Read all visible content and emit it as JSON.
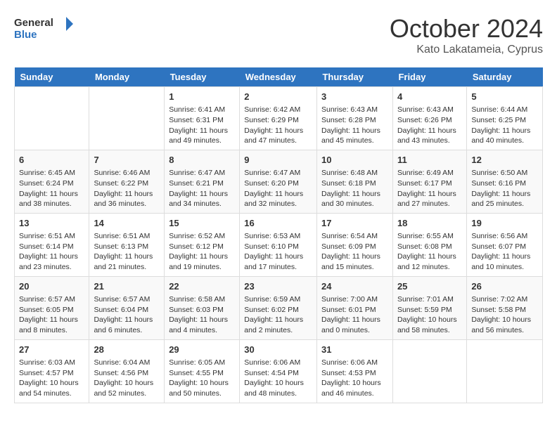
{
  "header": {
    "logo_line1": "General",
    "logo_line2": "Blue",
    "month": "October 2024",
    "location": "Kato Lakatameia, Cyprus"
  },
  "days_of_week": [
    "Sunday",
    "Monday",
    "Tuesday",
    "Wednesday",
    "Thursday",
    "Friday",
    "Saturday"
  ],
  "weeks": [
    [
      {
        "day": "",
        "text": ""
      },
      {
        "day": "",
        "text": ""
      },
      {
        "day": "1",
        "text": "Sunrise: 6:41 AM\nSunset: 6:31 PM\nDaylight: 11 hours and 49 minutes."
      },
      {
        "day": "2",
        "text": "Sunrise: 6:42 AM\nSunset: 6:29 PM\nDaylight: 11 hours and 47 minutes."
      },
      {
        "day": "3",
        "text": "Sunrise: 6:43 AM\nSunset: 6:28 PM\nDaylight: 11 hours and 45 minutes."
      },
      {
        "day": "4",
        "text": "Sunrise: 6:43 AM\nSunset: 6:26 PM\nDaylight: 11 hours and 43 minutes."
      },
      {
        "day": "5",
        "text": "Sunrise: 6:44 AM\nSunset: 6:25 PM\nDaylight: 11 hours and 40 minutes."
      }
    ],
    [
      {
        "day": "6",
        "text": "Sunrise: 6:45 AM\nSunset: 6:24 PM\nDaylight: 11 hours and 38 minutes."
      },
      {
        "day": "7",
        "text": "Sunrise: 6:46 AM\nSunset: 6:22 PM\nDaylight: 11 hours and 36 minutes."
      },
      {
        "day": "8",
        "text": "Sunrise: 6:47 AM\nSunset: 6:21 PM\nDaylight: 11 hours and 34 minutes."
      },
      {
        "day": "9",
        "text": "Sunrise: 6:47 AM\nSunset: 6:20 PM\nDaylight: 11 hours and 32 minutes."
      },
      {
        "day": "10",
        "text": "Sunrise: 6:48 AM\nSunset: 6:18 PM\nDaylight: 11 hours and 30 minutes."
      },
      {
        "day": "11",
        "text": "Sunrise: 6:49 AM\nSunset: 6:17 PM\nDaylight: 11 hours and 27 minutes."
      },
      {
        "day": "12",
        "text": "Sunrise: 6:50 AM\nSunset: 6:16 PM\nDaylight: 11 hours and 25 minutes."
      }
    ],
    [
      {
        "day": "13",
        "text": "Sunrise: 6:51 AM\nSunset: 6:14 PM\nDaylight: 11 hours and 23 minutes."
      },
      {
        "day": "14",
        "text": "Sunrise: 6:51 AM\nSunset: 6:13 PM\nDaylight: 11 hours and 21 minutes."
      },
      {
        "day": "15",
        "text": "Sunrise: 6:52 AM\nSunset: 6:12 PM\nDaylight: 11 hours and 19 minutes."
      },
      {
        "day": "16",
        "text": "Sunrise: 6:53 AM\nSunset: 6:10 PM\nDaylight: 11 hours and 17 minutes."
      },
      {
        "day": "17",
        "text": "Sunrise: 6:54 AM\nSunset: 6:09 PM\nDaylight: 11 hours and 15 minutes."
      },
      {
        "day": "18",
        "text": "Sunrise: 6:55 AM\nSunset: 6:08 PM\nDaylight: 11 hours and 12 minutes."
      },
      {
        "day": "19",
        "text": "Sunrise: 6:56 AM\nSunset: 6:07 PM\nDaylight: 11 hours and 10 minutes."
      }
    ],
    [
      {
        "day": "20",
        "text": "Sunrise: 6:57 AM\nSunset: 6:05 PM\nDaylight: 11 hours and 8 minutes."
      },
      {
        "day": "21",
        "text": "Sunrise: 6:57 AM\nSunset: 6:04 PM\nDaylight: 11 hours and 6 minutes."
      },
      {
        "day": "22",
        "text": "Sunrise: 6:58 AM\nSunset: 6:03 PM\nDaylight: 11 hours and 4 minutes."
      },
      {
        "day": "23",
        "text": "Sunrise: 6:59 AM\nSunset: 6:02 PM\nDaylight: 11 hours and 2 minutes."
      },
      {
        "day": "24",
        "text": "Sunrise: 7:00 AM\nSunset: 6:01 PM\nDaylight: 11 hours and 0 minutes."
      },
      {
        "day": "25",
        "text": "Sunrise: 7:01 AM\nSunset: 5:59 PM\nDaylight: 10 hours and 58 minutes."
      },
      {
        "day": "26",
        "text": "Sunrise: 7:02 AM\nSunset: 5:58 PM\nDaylight: 10 hours and 56 minutes."
      }
    ],
    [
      {
        "day": "27",
        "text": "Sunrise: 6:03 AM\nSunset: 4:57 PM\nDaylight: 10 hours and 54 minutes."
      },
      {
        "day": "28",
        "text": "Sunrise: 6:04 AM\nSunset: 4:56 PM\nDaylight: 10 hours and 52 minutes."
      },
      {
        "day": "29",
        "text": "Sunrise: 6:05 AM\nSunset: 4:55 PM\nDaylight: 10 hours and 50 minutes."
      },
      {
        "day": "30",
        "text": "Sunrise: 6:06 AM\nSunset: 4:54 PM\nDaylight: 10 hours and 48 minutes."
      },
      {
        "day": "31",
        "text": "Sunrise: 6:06 AM\nSunset: 4:53 PM\nDaylight: 10 hours and 46 minutes."
      },
      {
        "day": "",
        "text": ""
      },
      {
        "day": "",
        "text": ""
      }
    ]
  ]
}
